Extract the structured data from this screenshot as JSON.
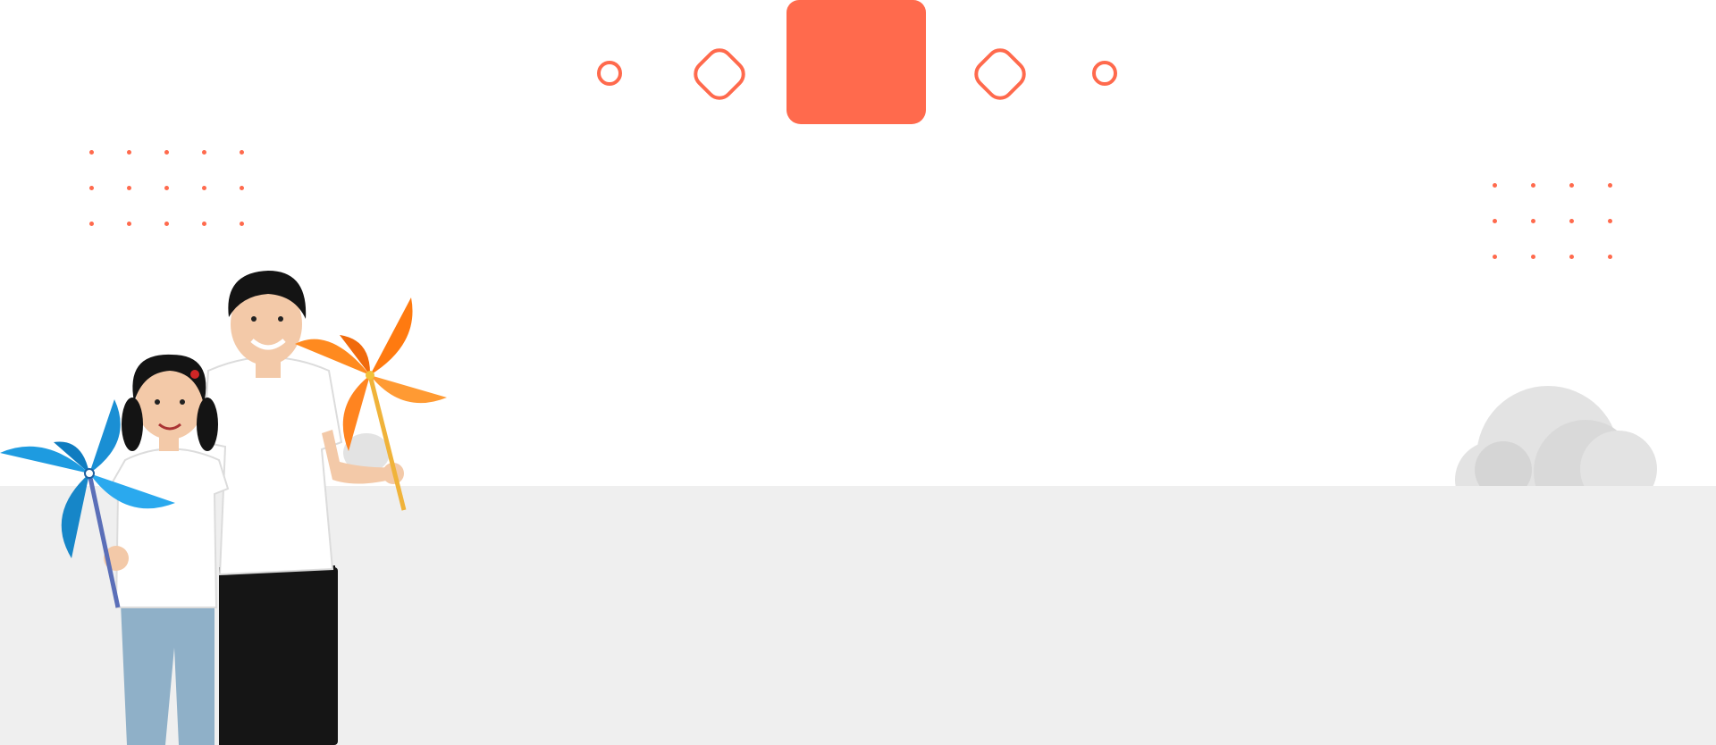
{
  "scene": {
    "description_tag": "hero-banner",
    "colors": {
      "accent": "#ff6a4d",
      "floor": "#efefef",
      "cloud": "#e3e3e3",
      "pinwheel_blue": "#1e9be0",
      "pinwheel_orange": "#ff8a1f"
    },
    "icons": [
      "ring-icon",
      "rounded-diamond-icon",
      "rounded-square-icon",
      "dot-grid-icon",
      "cloud-icon",
      "pinwheel-icon"
    ]
  }
}
